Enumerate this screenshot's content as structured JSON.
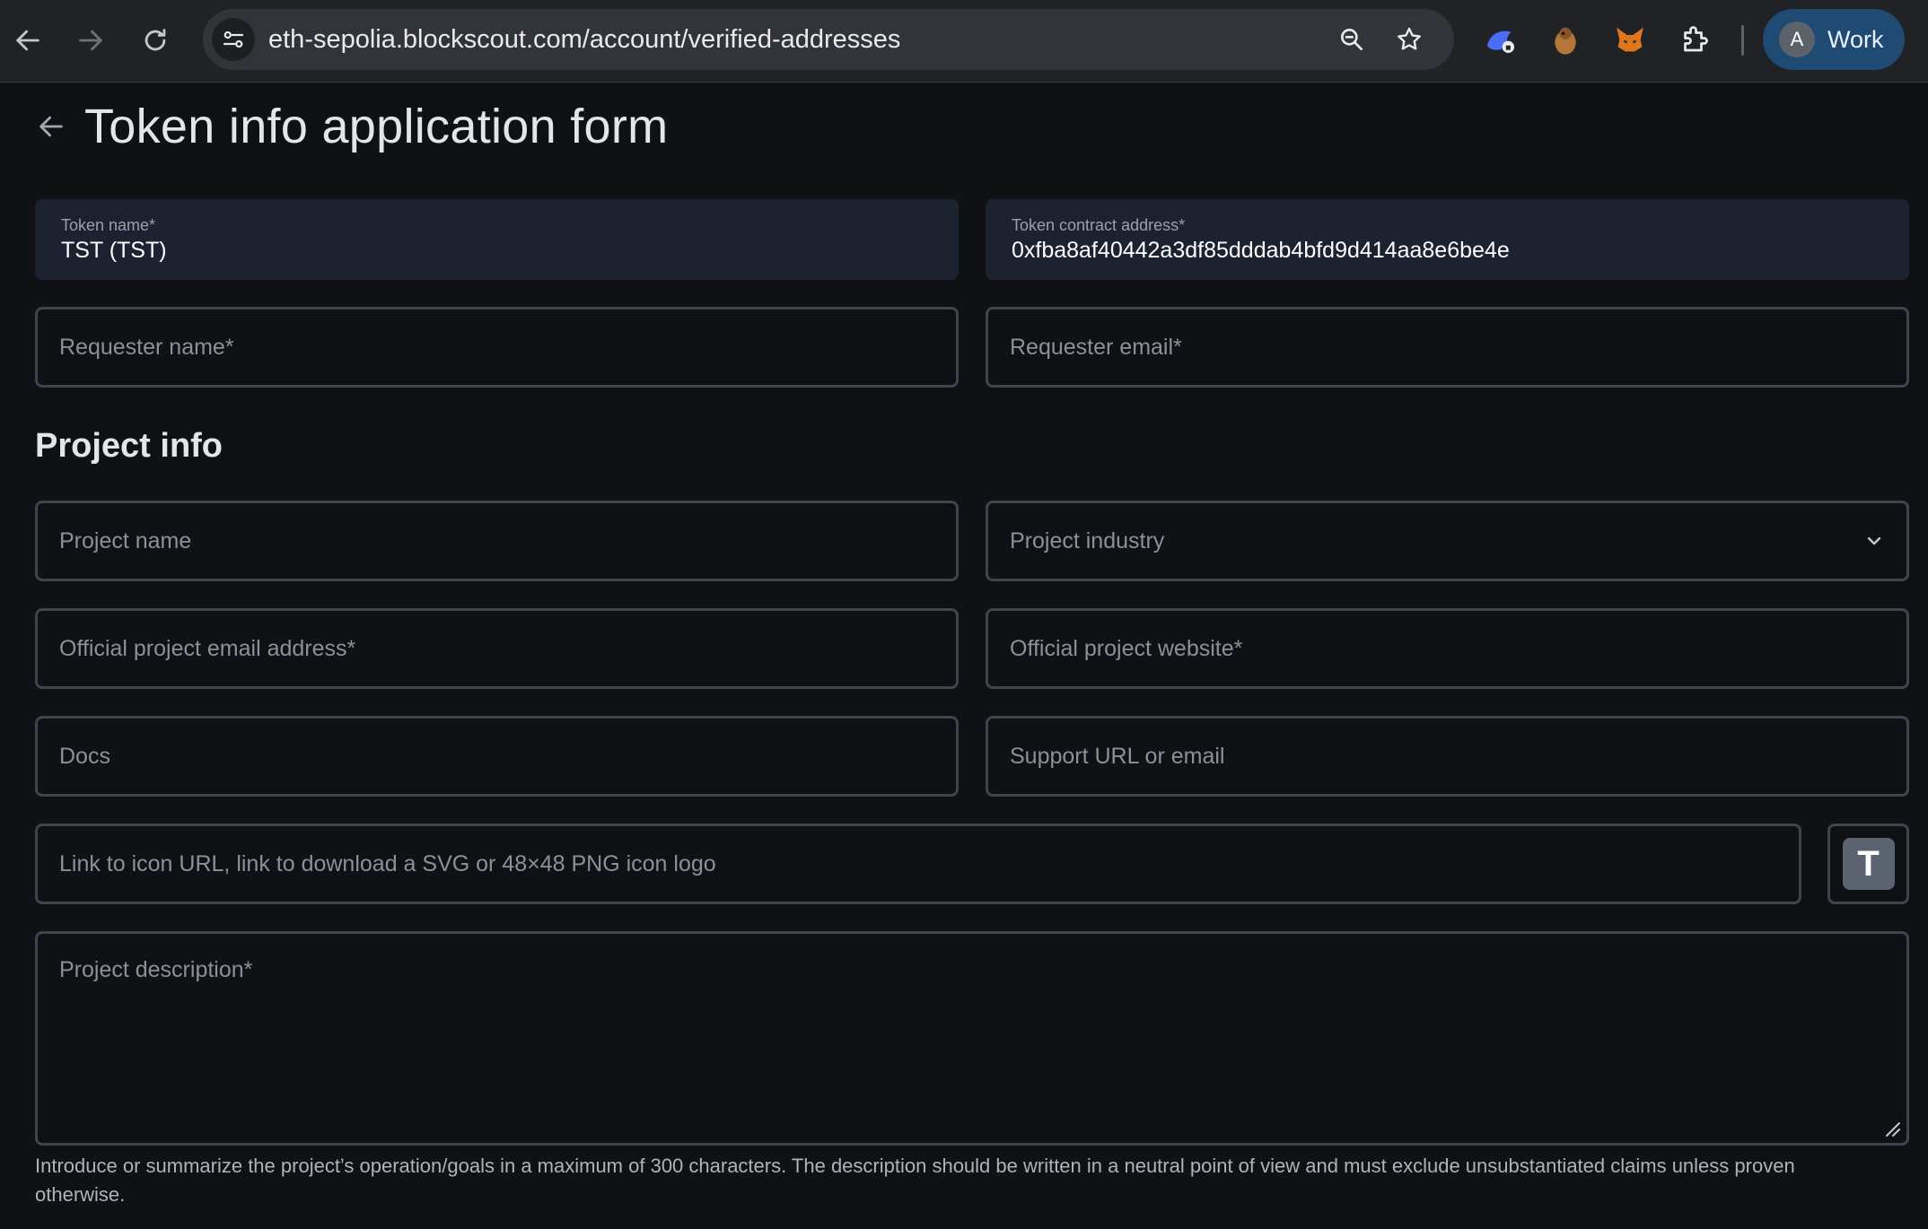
{
  "browser": {
    "url": "eth-sepolia.blockscout.com/account/verified-addresses",
    "profile_initial": "A",
    "profile_label": "Work",
    "icons": [
      "back-icon",
      "forward-icon",
      "reload-icon",
      "site-info-icon",
      "zoom-icon",
      "star-icon",
      "extension-icon",
      "puzzle-icon"
    ]
  },
  "page": {
    "title": "Token info application form",
    "section_project": "Project info"
  },
  "fields": {
    "token_name_label": "Token name*",
    "token_name_value": "TST (TST)",
    "token_address_label": "Token contract address*",
    "token_address_value": "0xfba8af40442a3df85dddab4bfd9d414aa8e6be4e",
    "requester_name": "Requester name*",
    "requester_email": "Requester email*",
    "project_name": "Project name",
    "project_industry": "Project industry",
    "project_email": "Official project email address*",
    "project_website": "Official project website*",
    "docs": "Docs",
    "support": "Support URL or email",
    "icon_url": "Link to icon URL, link to download a SVG or 48×48 PNG icon logo",
    "icon_preview_letter": "T",
    "description": "Project description*",
    "description_hint": "Introduce or summarize the project’s operation/goals in a maximum of 300 characters. The description should be written in a neutral point of view and must exclude unsubstantiated claims unless proven otherwise."
  },
  "colors": {
    "page_bg": "#101114",
    "field_border": "#40444e",
    "filled_bg": "#1c2230",
    "profile_bg": "#1f4a74"
  }
}
